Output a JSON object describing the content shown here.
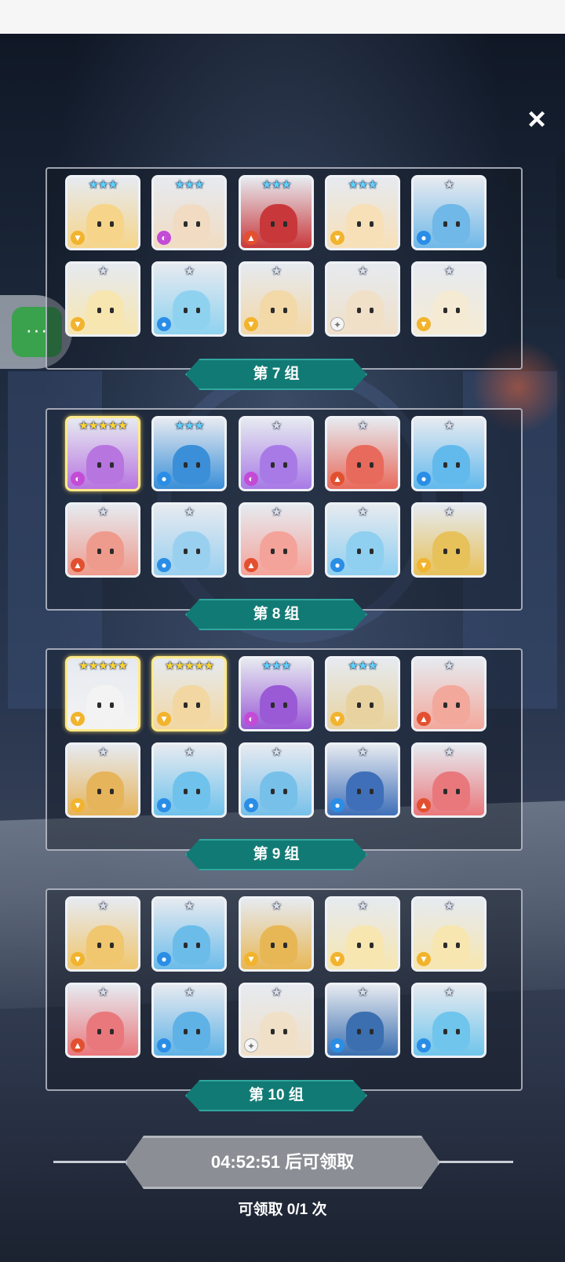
{
  "close_icon": "×",
  "floating_widget_icon": "···",
  "colors": {
    "group_label_bg": "#127a74",
    "claim_button_bg": "#8b8f95",
    "star_silver": "#d9dee6",
    "star_blue": "#5fd2ff",
    "star_gold": "#ffd633"
  },
  "groups": [
    {
      "label": "第 7 组",
      "cards": [
        {
          "stars": "★★★",
          "rank": 3,
          "element": "earth",
          "color": "#f6d58a"
        },
        {
          "stars": "★★★",
          "rank": 3,
          "element": "dark",
          "color": "#f1dcc3"
        },
        {
          "stars": "★★★",
          "rank": 3,
          "element": "fire",
          "color": "#c8383b"
        },
        {
          "stars": "★★★",
          "rank": 3,
          "element": "earth",
          "color": "#f7e0b8"
        },
        {
          "stars": "★",
          "rank": 1,
          "element": "water",
          "color": "#6fb8e8"
        },
        {
          "stars": "★",
          "rank": 1,
          "element": "earth",
          "color": "#f7e6b0"
        },
        {
          "stars": "★",
          "rank": 1,
          "element": "water",
          "color": "#8fd2ef"
        },
        {
          "stars": "★",
          "rank": 1,
          "element": "earth",
          "color": "#f3d8a8"
        },
        {
          "stars": "★",
          "rank": 1,
          "element": "light",
          "color": "#f0e0c8"
        },
        {
          "stars": "★",
          "rank": 1,
          "element": "earth",
          "color": "#f5ebd4"
        }
      ]
    },
    {
      "label": "第 8 组",
      "cards": [
        {
          "stars": "★★★★★",
          "rank": 5,
          "element": "dark",
          "color": "#b775e0"
        },
        {
          "stars": "★★★",
          "rank": 3,
          "element": "water",
          "color": "#3a8fd8"
        },
        {
          "stars": "★",
          "rank": 1,
          "element": "dark",
          "color": "#a87ae6"
        },
        {
          "stars": "★",
          "rank": 1,
          "element": "fire",
          "color": "#e86a5c"
        },
        {
          "stars": "★",
          "rank": 1,
          "element": "water",
          "color": "#62b9ec"
        },
        {
          "stars": "★",
          "rank": 1,
          "element": "fire",
          "color": "#ee9b8d"
        },
        {
          "stars": "★",
          "rank": 1,
          "element": "water",
          "color": "#9ad0ef"
        },
        {
          "stars": "★",
          "rank": 1,
          "element": "fire",
          "color": "#f4a39a"
        },
        {
          "stars": "★",
          "rank": 1,
          "element": "water",
          "color": "#8fcff0"
        },
        {
          "stars": "★",
          "rank": 1,
          "element": "earth",
          "color": "#e7c15a"
        }
      ]
    },
    {
      "label": "第 9 组",
      "cards": [
        {
          "stars": "★★★★★",
          "rank": 5,
          "element": "earth",
          "color": "#f3f3f3"
        },
        {
          "stars": "★★★★★",
          "rank": 5,
          "element": "earth",
          "color": "#f2d7a2"
        },
        {
          "stars": "★★★",
          "rank": 3,
          "element": "dark",
          "color": "#9a5ad6"
        },
        {
          "stars": "★★★",
          "rank": 3,
          "element": "earth",
          "color": "#e8d3a0"
        },
        {
          "stars": "★",
          "rank": 1,
          "element": "fire",
          "color": "#f3a89c"
        },
        {
          "stars": "★",
          "rank": 1,
          "element": "earth",
          "color": "#e6b45a"
        },
        {
          "stars": "★",
          "rank": 1,
          "element": "water",
          "color": "#6fc2ec"
        },
        {
          "stars": "★",
          "rank": 1,
          "element": "water",
          "color": "#77c0ea"
        },
        {
          "stars": "★",
          "rank": 1,
          "element": "water",
          "color": "#3f6fb8"
        },
        {
          "stars": "★",
          "rank": 1,
          "element": "fire",
          "color": "#e9787c"
        }
      ]
    },
    {
      "label": "第 10 组",
      "cards": [
        {
          "stars": "★",
          "rank": 1,
          "element": "earth",
          "color": "#f0c66e"
        },
        {
          "stars": "★",
          "rank": 1,
          "element": "water",
          "color": "#6cbcea"
        },
        {
          "stars": "★",
          "rank": 1,
          "element": "earth",
          "color": "#e8b755"
        },
        {
          "stars": "★",
          "rank": 1,
          "element": "earth",
          "color": "#f7e6b0"
        },
        {
          "stars": "★",
          "rank": 1,
          "element": "earth",
          "color": "#f7e6b0"
        },
        {
          "stars": "★",
          "rank": 1,
          "element": "fire",
          "color": "#e9787c"
        },
        {
          "stars": "★",
          "rank": 1,
          "element": "water",
          "color": "#5fb2e6"
        },
        {
          "stars": "★",
          "rank": 1,
          "element": "light",
          "color": "#f0e0c8"
        },
        {
          "stars": "★",
          "rank": 1,
          "element": "water",
          "color": "#3b6fb0"
        },
        {
          "stars": "★",
          "rank": 1,
          "element": "water",
          "color": "#6fc5ec"
        }
      ]
    }
  ],
  "claim": {
    "button_label": "04:52:51 后可领取",
    "count_text": "可领取 0/1 次"
  }
}
